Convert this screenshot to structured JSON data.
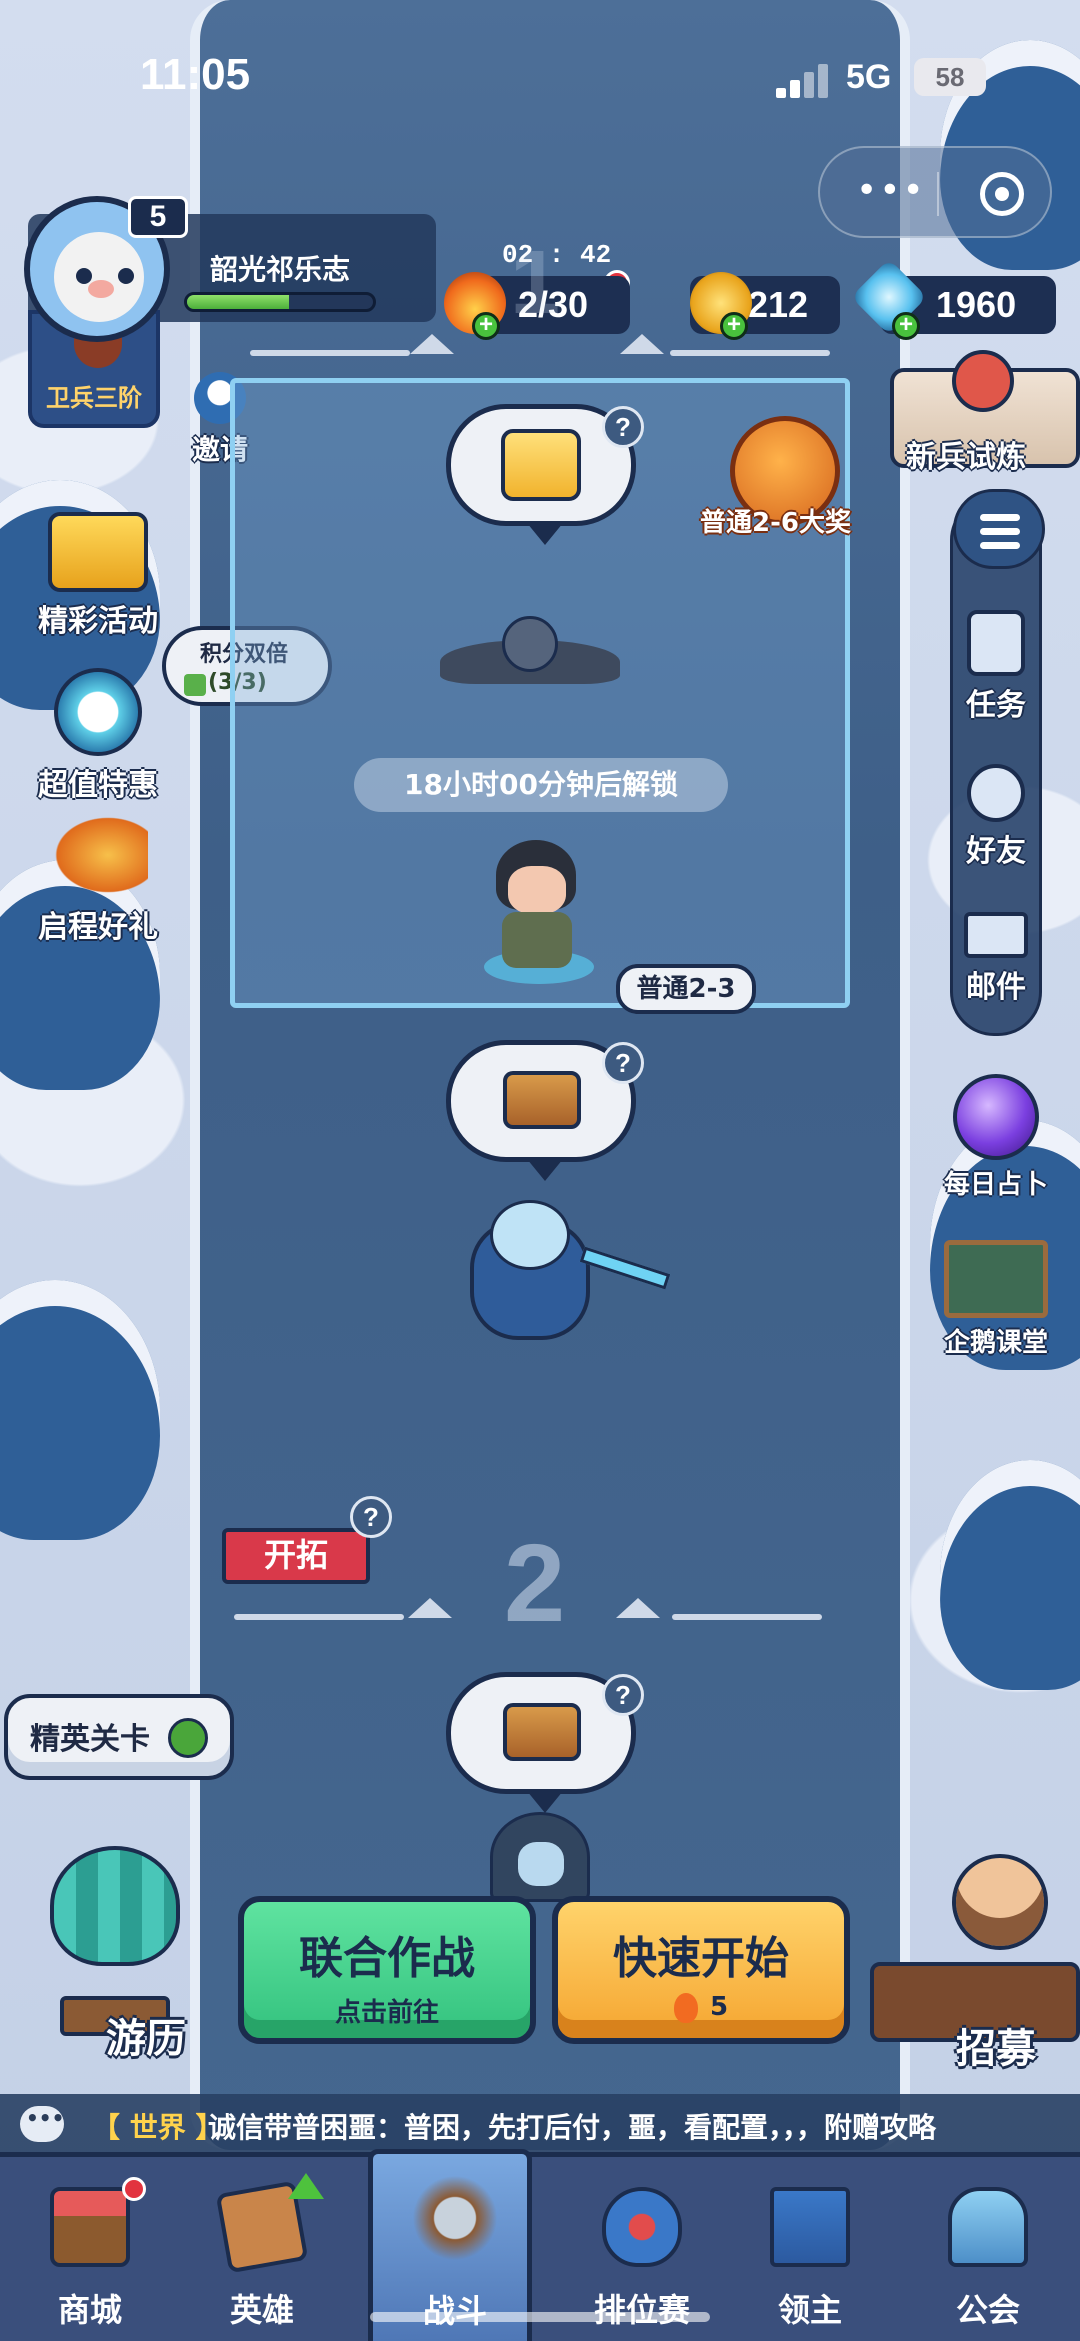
{
  "status_bar": {
    "time": "11:05",
    "network": "5G",
    "battery": "58"
  },
  "player": {
    "level": "5",
    "name": "韶光祁乐志",
    "rank": "卫兵三阶",
    "xp_fraction": 0.55
  },
  "resources": {
    "timer": "02 : 42",
    "energy": "2/30",
    "gold": "212",
    "gems": "1960"
  },
  "left_menu": {
    "invite": "邀请",
    "events": "精彩活动",
    "double_points": {
      "line1": "积分双倍",
      "line2": "(3/3)"
    },
    "deals": "超值特惠",
    "gift": "启程好礼"
  },
  "right_menu": {
    "trial": "新兵试炼",
    "tasks": "任务",
    "friends": "好友",
    "mail": "邮件",
    "fortune": "每日占卜",
    "class": "企鹅课堂"
  },
  "stage": {
    "reward_label": "普通2-6大奖",
    "unlock_text": "18小时00分钟后解锁",
    "current_stage": "普通2-3",
    "chapter1": "1",
    "chapter2": "2",
    "explore_flag": "开拓",
    "question": "?"
  },
  "actions": {
    "elite": "精英关卡",
    "coop_title": "联合作战",
    "coop_sub": "点击前往",
    "quick_title": "快速开始",
    "quick_cost": "5",
    "travel": "游历",
    "recruit": "招募"
  },
  "chat": {
    "channel": "【 世界 】",
    "message": "诚信带普困噩：普困，先打后付，噩，看配置，，，附赠攻略"
  },
  "tabs": [
    {
      "label": "商城"
    },
    {
      "label": "英雄"
    },
    {
      "label": "战斗"
    },
    {
      "label": "排位赛"
    },
    {
      "label": "领主"
    },
    {
      "label": "公会"
    }
  ],
  "colors": {
    "river": "#3e5f88",
    "accent_green": "#33c27e",
    "accent_orange": "#f5a530",
    "tabbar": "#3a4f7c"
  }
}
